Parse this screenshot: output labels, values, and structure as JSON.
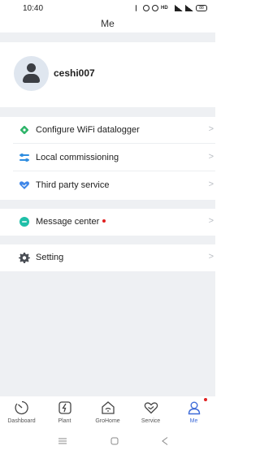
{
  "status_bar": {
    "time": "10:40",
    "hd_label": "HD",
    "battery": "88"
  },
  "header": {
    "title": "Me"
  },
  "profile": {
    "username": "ceshi007"
  },
  "menu": {
    "items": [
      {
        "label": "Configure WiFi datalogger",
        "icon": "wifi-datalogger-icon",
        "color": "#2fb56a"
      },
      {
        "label": "Local commissioning",
        "icon": "commissioning-icon",
        "color": "#2f8de0"
      },
      {
        "label": "Third party service",
        "icon": "handshake-icon",
        "color": "#3f86e8"
      },
      {
        "label": "Message center",
        "icon": "message-icon",
        "color": "#1fbfa8",
        "badge": true
      },
      {
        "label": "Setting",
        "icon": "gear-icon",
        "color": "#4a4e55"
      }
    ],
    "chevron": ">"
  },
  "bottom_nav": {
    "items": [
      {
        "label": "Dashboard",
        "icon": "dashboard-icon"
      },
      {
        "label": "Plant",
        "icon": "plant-icon"
      },
      {
        "label": "GroHome",
        "icon": "grohome-icon"
      },
      {
        "label": "Service",
        "icon": "service-icon"
      },
      {
        "label": "Me",
        "icon": "person-icon",
        "active": true
      }
    ],
    "active_color": "#3f6cd8"
  },
  "system_nav": {
    "buttons": [
      "menu-icon",
      "home-icon",
      "back-icon"
    ]
  }
}
